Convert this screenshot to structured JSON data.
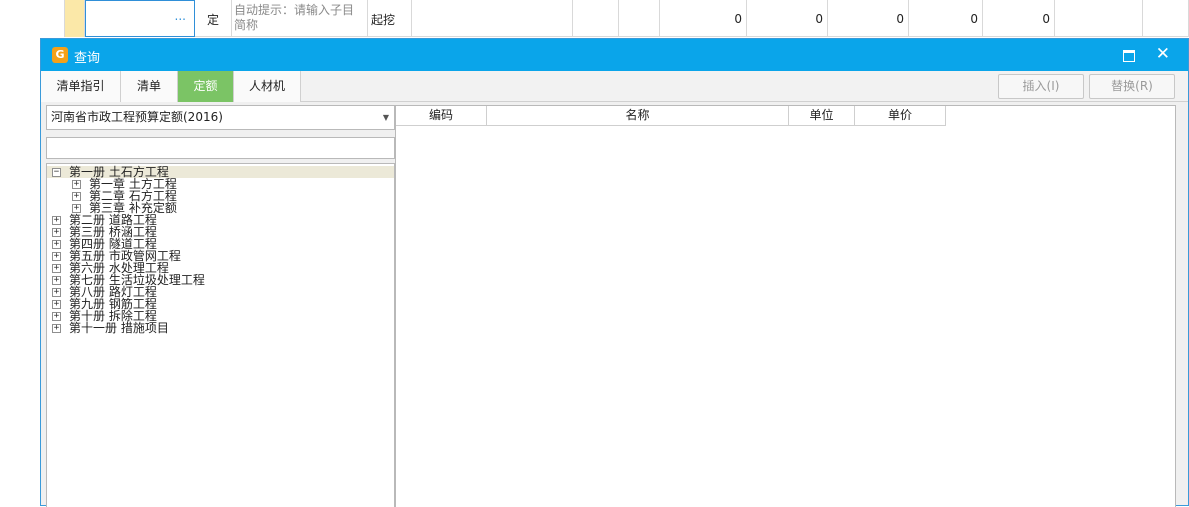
{
  "background_sheet": {
    "row": {
      "picker_label": "...",
      "type_label": "定",
      "hint_text": "自动提示：请输入子目简称",
      "name_text": "起挖",
      "values": [
        "0",
        "0",
        "0",
        "0",
        "0"
      ]
    }
  },
  "dialog": {
    "title": "查询",
    "tabs": [
      {
        "label": "清单指引",
        "active": false
      },
      {
        "label": "清单",
        "active": false
      },
      {
        "label": "定额",
        "active": true
      },
      {
        "label": "人材机",
        "active": false
      }
    ],
    "insert_label": "插入(I)",
    "replace_label": "替换(R)",
    "library_selected": "河南省市政工程预算定额(2016)",
    "search_value": "",
    "tree": [
      {
        "label": "第一册 土石方工程",
        "level": 0,
        "toggle": "−",
        "selected": true
      },
      {
        "label": "第一章 土方工程",
        "level": 1,
        "toggle": "+",
        "selected": false
      },
      {
        "label": "第二章 石方工程",
        "level": 1,
        "toggle": "+",
        "selected": false
      },
      {
        "label": "第三章 补充定额",
        "level": 1,
        "toggle": "+",
        "selected": false
      },
      {
        "label": "第二册 道路工程",
        "level": 0,
        "toggle": "+",
        "selected": false
      },
      {
        "label": "第三册 桥涵工程",
        "level": 0,
        "toggle": "+",
        "selected": false
      },
      {
        "label": "第四册 隧道工程",
        "level": 0,
        "toggle": "+",
        "selected": false
      },
      {
        "label": "第五册 市政管网工程",
        "level": 0,
        "toggle": "+",
        "selected": false
      },
      {
        "label": "第六册 水处理工程",
        "level": 0,
        "toggle": "+",
        "selected": false
      },
      {
        "label": "第七册 生活垃圾处理工程",
        "level": 0,
        "toggle": "+",
        "selected": false
      },
      {
        "label": "第八册 路灯工程",
        "level": 0,
        "toggle": "+",
        "selected": false
      },
      {
        "label": "第九册 钢筋工程",
        "level": 0,
        "toggle": "+",
        "selected": false
      },
      {
        "label": "第十册 拆除工程",
        "level": 0,
        "toggle": "+",
        "selected": false
      },
      {
        "label": "第十一册 措施项目",
        "level": 0,
        "toggle": "+",
        "selected": false
      }
    ],
    "grid_columns": [
      "编码",
      "名称",
      "单位",
      "单价"
    ]
  },
  "colors": {
    "titlebar": "#0aa5ea",
    "active_tab": "#7bc465",
    "tree_selected": "#ece9d8"
  }
}
